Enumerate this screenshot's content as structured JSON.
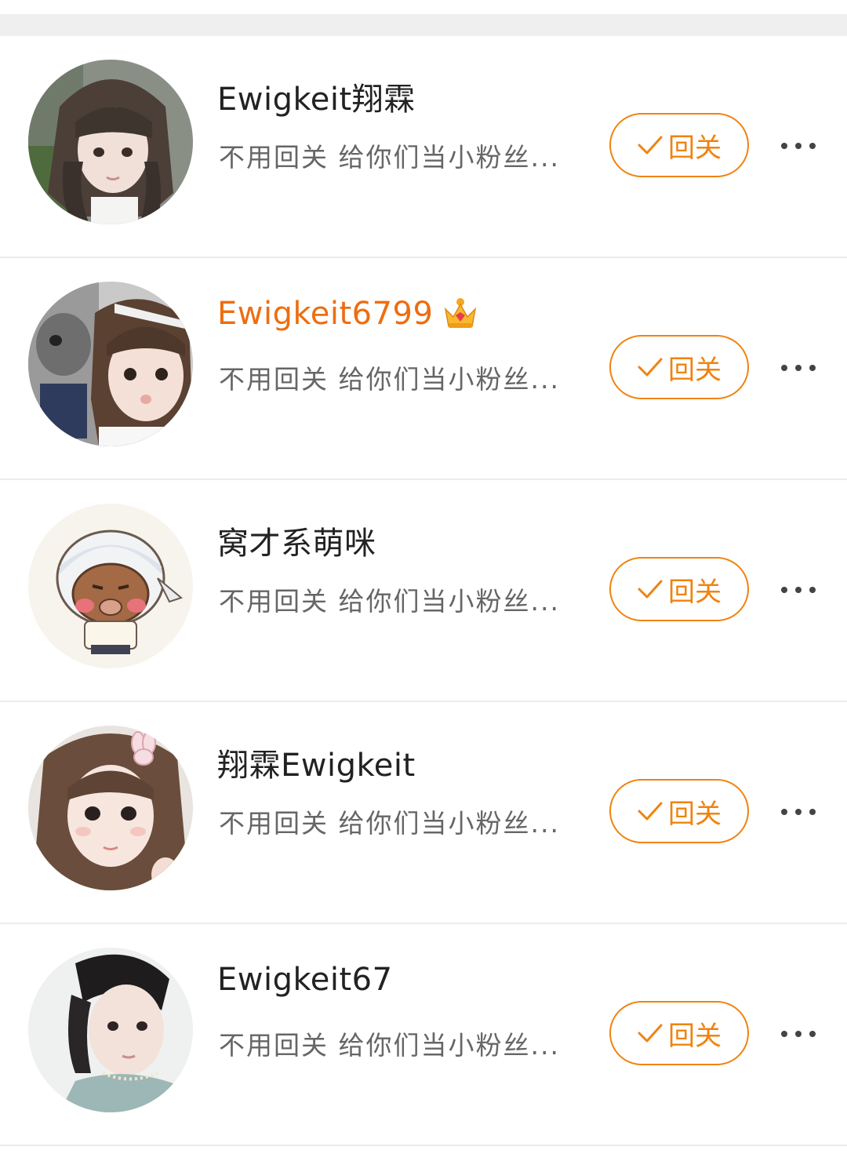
{
  "users": [
    {
      "name": "Ewigkeit翔霖",
      "vip": false,
      "bio": "不用回关 给你们当小粉丝...",
      "follow_label": "回关",
      "avatar": "photo-girl-dark-hair"
    },
    {
      "name": "Ewigkeit6799",
      "vip": true,
      "bio": "不用回关 给你们当小粉丝...",
      "follow_label": "回关",
      "avatar": "photo-girl-with-dog"
    },
    {
      "name": "窝才系萌咪",
      "vip": false,
      "bio": "不用回关 给你们当小粉丝...",
      "follow_label": "回关",
      "avatar": "cartoon-kid-headscarf"
    },
    {
      "name": "翔霖Ewigkeit",
      "vip": false,
      "bio": "不用回关 给你们当小粉丝...",
      "follow_label": "回关",
      "avatar": "photo-girl-bunny-clip"
    },
    {
      "name": "Ewigkeit67",
      "vip": false,
      "bio": "不用回关 给你们当小粉丝...",
      "follow_label": "回关",
      "avatar": "photo-girl-necklace"
    }
  ],
  "icons": {
    "check": "check-icon",
    "more": "more-icon",
    "vip": "crown-icon"
  },
  "colors": {
    "accent": "#f0830f",
    "vip_name": "#ee6d10",
    "name": "#222222",
    "bio": "#666666",
    "divider": "#ececec"
  }
}
